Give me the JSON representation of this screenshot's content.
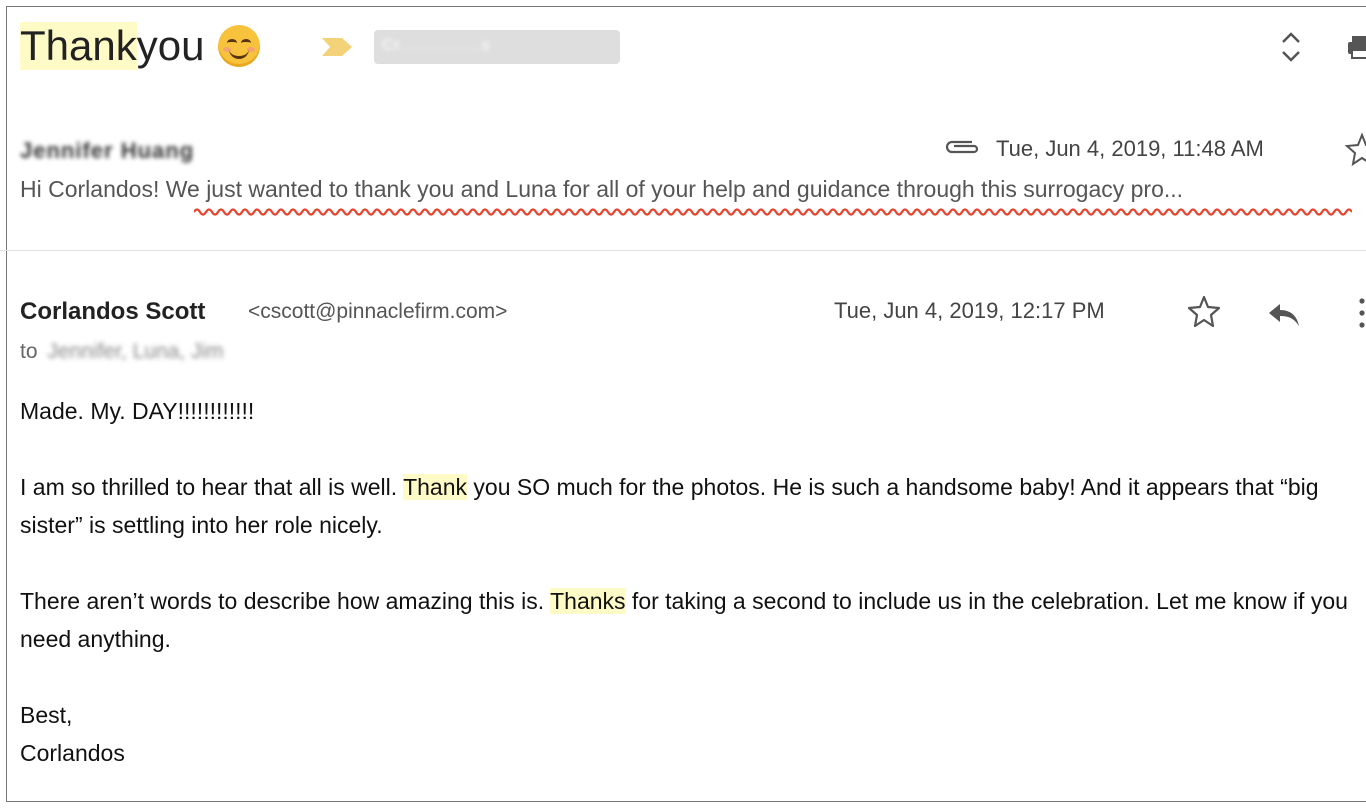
{
  "thread": {
    "subject_highlight": "Thank",
    "subject_rest": " you",
    "label_chip": "Cr...............s"
  },
  "collapsed_message": {
    "sender": "Jennifer Huang",
    "date": "Tue, Jun 4, 2019, 11:48 AM",
    "snippet": "Hi Corlandos! We just wanted to thank you and Luna for all of your help and guidance through this surrogacy pro..."
  },
  "open_message": {
    "sender_name": "Corlandos Scott",
    "sender_email": "<cscott@pinnaclefirm.com>",
    "date": "Tue, Jun 4, 2019, 12:17 PM",
    "to_label": "to",
    "to_recipients": "Jennifer, Luna, Jim",
    "body": {
      "line1": "Made. My. DAY!!!!!!!!!!!!",
      "p2_before": "I am so thrilled to hear that all is well.  ",
      "p2_highlight": "Thank",
      "p2_after": " you SO much for the photos.  He is such a handsome baby!  And it appears that “big sister” is settling into her role nicely.",
      "p3_before": "There aren’t words to describe how amazing this is.  ",
      "p3_highlight": "Thanks",
      "p3_after": " for taking a second to include us in the celebration.  Let me know if you need anything.",
      "signoff": "Best,",
      "signature": "Corlandos"
    }
  },
  "icons": {
    "emoji": "smiling-face-icon",
    "label_marker": "important-marker-icon",
    "expand": "expand-all-icon",
    "print": "print-icon",
    "attachment": "paperclip-icon",
    "star": "star-icon",
    "reply": "reply-icon",
    "more": "more-vertical-icon"
  },
  "colors": {
    "highlight": "#fffbc6",
    "important_marker": "#f4d27a",
    "spellcheck_underline": "#e8432e"
  }
}
